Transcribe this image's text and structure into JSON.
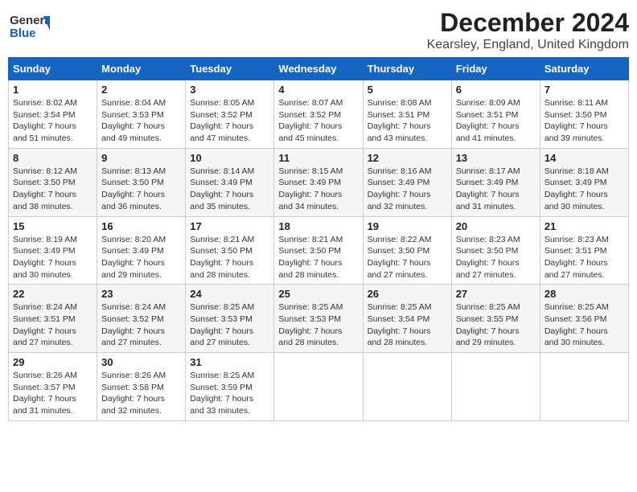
{
  "header": {
    "title": "December 2024",
    "subtitle": "Kearsley, England, United Kingdom",
    "logo_line1": "General",
    "logo_line2": "Blue"
  },
  "columns": [
    "Sunday",
    "Monday",
    "Tuesday",
    "Wednesday",
    "Thursday",
    "Friday",
    "Saturday"
  ],
  "weeks": [
    [
      {
        "day": "1",
        "sunrise": "Sunrise: 8:02 AM",
        "sunset": "Sunset: 3:54 PM",
        "daylight": "Daylight: 7 hours and 51 minutes."
      },
      {
        "day": "2",
        "sunrise": "Sunrise: 8:04 AM",
        "sunset": "Sunset: 3:53 PM",
        "daylight": "Daylight: 7 hours and 49 minutes."
      },
      {
        "day": "3",
        "sunrise": "Sunrise: 8:05 AM",
        "sunset": "Sunset: 3:52 PM",
        "daylight": "Daylight: 7 hours and 47 minutes."
      },
      {
        "day": "4",
        "sunrise": "Sunrise: 8:07 AM",
        "sunset": "Sunset: 3:52 PM",
        "daylight": "Daylight: 7 hours and 45 minutes."
      },
      {
        "day": "5",
        "sunrise": "Sunrise: 8:08 AM",
        "sunset": "Sunset: 3:51 PM",
        "daylight": "Daylight: 7 hours and 43 minutes."
      },
      {
        "day": "6",
        "sunrise": "Sunrise: 8:09 AM",
        "sunset": "Sunset: 3:51 PM",
        "daylight": "Daylight: 7 hours and 41 minutes."
      },
      {
        "day": "7",
        "sunrise": "Sunrise: 8:11 AM",
        "sunset": "Sunset: 3:50 PM",
        "daylight": "Daylight: 7 hours and 39 minutes."
      }
    ],
    [
      {
        "day": "8",
        "sunrise": "Sunrise: 8:12 AM",
        "sunset": "Sunset: 3:50 PM",
        "daylight": "Daylight: 7 hours and 38 minutes."
      },
      {
        "day": "9",
        "sunrise": "Sunrise: 8:13 AM",
        "sunset": "Sunset: 3:50 PM",
        "daylight": "Daylight: 7 hours and 36 minutes."
      },
      {
        "day": "10",
        "sunrise": "Sunrise: 8:14 AM",
        "sunset": "Sunset: 3:49 PM",
        "daylight": "Daylight: 7 hours and 35 minutes."
      },
      {
        "day": "11",
        "sunrise": "Sunrise: 8:15 AM",
        "sunset": "Sunset: 3:49 PM",
        "daylight": "Daylight: 7 hours and 34 minutes."
      },
      {
        "day": "12",
        "sunrise": "Sunrise: 8:16 AM",
        "sunset": "Sunset: 3:49 PM",
        "daylight": "Daylight: 7 hours and 32 minutes."
      },
      {
        "day": "13",
        "sunrise": "Sunrise: 8:17 AM",
        "sunset": "Sunset: 3:49 PM",
        "daylight": "Daylight: 7 hours and 31 minutes."
      },
      {
        "day": "14",
        "sunrise": "Sunrise: 8:18 AM",
        "sunset": "Sunset: 3:49 PM",
        "daylight": "Daylight: 7 hours and 30 minutes."
      }
    ],
    [
      {
        "day": "15",
        "sunrise": "Sunrise: 8:19 AM",
        "sunset": "Sunset: 3:49 PM",
        "daylight": "Daylight: 7 hours and 30 minutes."
      },
      {
        "day": "16",
        "sunrise": "Sunrise: 8:20 AM",
        "sunset": "Sunset: 3:49 PM",
        "daylight": "Daylight: 7 hours and 29 minutes."
      },
      {
        "day": "17",
        "sunrise": "Sunrise: 8:21 AM",
        "sunset": "Sunset: 3:50 PM",
        "daylight": "Daylight: 7 hours and 28 minutes."
      },
      {
        "day": "18",
        "sunrise": "Sunrise: 8:21 AM",
        "sunset": "Sunset: 3:50 PM",
        "daylight": "Daylight: 7 hours and 28 minutes."
      },
      {
        "day": "19",
        "sunrise": "Sunrise: 8:22 AM",
        "sunset": "Sunset: 3:50 PM",
        "daylight": "Daylight: 7 hours and 27 minutes."
      },
      {
        "day": "20",
        "sunrise": "Sunrise: 8:23 AM",
        "sunset": "Sunset: 3:50 PM",
        "daylight": "Daylight: 7 hours and 27 minutes."
      },
      {
        "day": "21",
        "sunrise": "Sunrise: 8:23 AM",
        "sunset": "Sunset: 3:51 PM",
        "daylight": "Daylight: 7 hours and 27 minutes."
      }
    ],
    [
      {
        "day": "22",
        "sunrise": "Sunrise: 8:24 AM",
        "sunset": "Sunset: 3:51 PM",
        "daylight": "Daylight: 7 hours and 27 minutes."
      },
      {
        "day": "23",
        "sunrise": "Sunrise: 8:24 AM",
        "sunset": "Sunset: 3:52 PM",
        "daylight": "Daylight: 7 hours and 27 minutes."
      },
      {
        "day": "24",
        "sunrise": "Sunrise: 8:25 AM",
        "sunset": "Sunset: 3:53 PM",
        "daylight": "Daylight: 7 hours and 27 minutes."
      },
      {
        "day": "25",
        "sunrise": "Sunrise: 8:25 AM",
        "sunset": "Sunset: 3:53 PM",
        "daylight": "Daylight: 7 hours and 28 minutes."
      },
      {
        "day": "26",
        "sunrise": "Sunrise: 8:25 AM",
        "sunset": "Sunset: 3:54 PM",
        "daylight": "Daylight: 7 hours and 28 minutes."
      },
      {
        "day": "27",
        "sunrise": "Sunrise: 8:25 AM",
        "sunset": "Sunset: 3:55 PM",
        "daylight": "Daylight: 7 hours and 29 minutes."
      },
      {
        "day": "28",
        "sunrise": "Sunrise: 8:25 AM",
        "sunset": "Sunset: 3:56 PM",
        "daylight": "Daylight: 7 hours and 30 minutes."
      }
    ],
    [
      {
        "day": "29",
        "sunrise": "Sunrise: 8:26 AM",
        "sunset": "Sunset: 3:57 PM",
        "daylight": "Daylight: 7 hours and 31 minutes."
      },
      {
        "day": "30",
        "sunrise": "Sunrise: 8:26 AM",
        "sunset": "Sunset: 3:58 PM",
        "daylight": "Daylight: 7 hours and 32 minutes."
      },
      {
        "day": "31",
        "sunrise": "Sunrise: 8:25 AM",
        "sunset": "Sunset: 3:59 PM",
        "daylight": "Daylight: 7 hours and 33 minutes."
      },
      null,
      null,
      null,
      null
    ]
  ]
}
